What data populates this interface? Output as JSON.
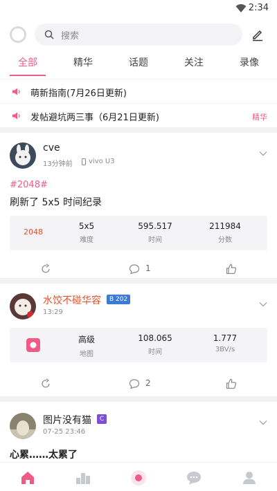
{
  "status": {
    "time": "2:34"
  },
  "search": {
    "placeholder": "搜索"
  },
  "tabs": [
    {
      "label": "全部",
      "active": true
    },
    {
      "label": "精华"
    },
    {
      "label": "话题"
    },
    {
      "label": "关注"
    },
    {
      "label": "录像"
    }
  ],
  "notices": [
    {
      "text": "萌新指南(7月26日更新)",
      "tag": ""
    },
    {
      "text": "发帖避坑两三事（6月21日更新)",
      "tag": "精华"
    }
  ],
  "posts": [
    {
      "user": "cve",
      "time": "13分钟前",
      "device": "vivo U3",
      "hashtag": "#2048#",
      "content": "刷新了 5x5 时间纪录",
      "game_label": "2048",
      "stats": [
        {
          "value": "5x5",
          "label": "难度"
        },
        {
          "value": "595.517",
          "label": "时间"
        },
        {
          "value": "211984",
          "label": "分数"
        }
      ],
      "comments": "1"
    },
    {
      "user": "水饺不碰华容",
      "badge": "B 202",
      "time": "13:29",
      "stats": [
        {
          "value": "高级",
          "label": "地图"
        },
        {
          "value": "108.065",
          "label": "时间"
        },
        {
          "value": "1.777",
          "label": "3BV/s"
        }
      ],
      "comments": "2"
    },
    {
      "user": "图片没有猫",
      "badge": "C",
      "time": "07-25 23:46",
      "content": "心累……太累了"
    }
  ],
  "colors": {
    "accent": "#ef5a87",
    "highlight_name": "#e0502b",
    "badge_blue": "#3a7bd5",
    "badge_purple": "#7b4fd6"
  }
}
